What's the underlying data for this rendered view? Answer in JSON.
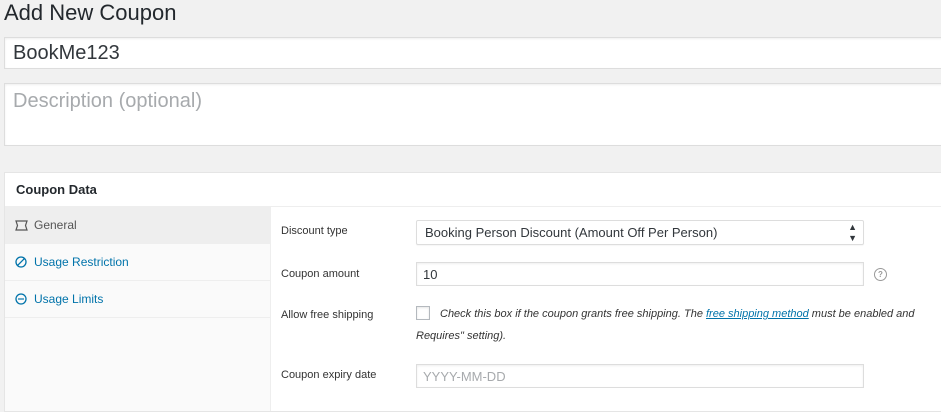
{
  "page": {
    "title": "Add New Coupon",
    "coupon_code_value": "BookMe123",
    "description_placeholder": "Description (optional)"
  },
  "coupon_data": {
    "heading": "Coupon Data",
    "tabs": [
      {
        "label": "General",
        "icon": "ticket-icon",
        "active": true
      },
      {
        "label": "Usage Restriction",
        "icon": "ban-icon",
        "active": false
      },
      {
        "label": "Usage Limits",
        "icon": "limits-icon",
        "active": false
      }
    ],
    "general": {
      "discount_type_label": "Discount type",
      "discount_type_value": "Booking Person Discount (Amount Off Per Person)",
      "coupon_amount_label": "Coupon amount",
      "coupon_amount_value": "10",
      "free_shipping_label": "Allow free shipping",
      "free_shipping_text_before": "Check this box if the coupon grants free shipping. The ",
      "free_shipping_link": "free shipping method",
      "free_shipping_text_after": " must be enabled and",
      "free_shipping_text_line2": "Requires\" setting).",
      "expiry_label": "Coupon expiry date",
      "expiry_placeholder": "YYYY-MM-DD"
    }
  },
  "colors": {
    "link": "#0073aa",
    "background": "#f1f1f1"
  }
}
